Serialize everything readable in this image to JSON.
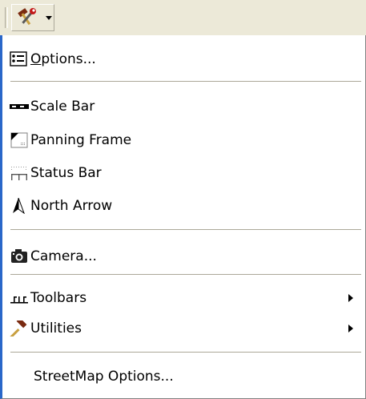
{
  "toolbar": {
    "tool_icon": "hammer-wrench-icon",
    "dropdown_icon": "dropdown-arrow-icon"
  },
  "menu": {
    "options": {
      "mnemonic": "O",
      "rest": "ptions...",
      "icon": "options-icon"
    },
    "scale_bar": {
      "label": "Scale Bar",
      "icon": "scale-bar-icon"
    },
    "panning_frame": {
      "label": "Panning Frame",
      "icon": "panning-frame-icon"
    },
    "status_bar": {
      "label": "Status Bar",
      "icon": "status-bar-icon"
    },
    "north_arrow": {
      "label": "North Arrow",
      "icon": "north-arrow-icon"
    },
    "camera": {
      "label": "Camera...",
      "icon": "camera-icon"
    },
    "toolbars": {
      "label": "Toolbars",
      "icon": "toolbars-icon"
    },
    "utilities": {
      "label": "Utilities",
      "icon": "hammer-icon"
    },
    "streetmap_options": {
      "label": "StreetMap Options..."
    }
  },
  "colors": {
    "toolbar_bg": "#ece9d8",
    "menu_border_accent": "#2a67c9",
    "separator": "#aca899"
  }
}
